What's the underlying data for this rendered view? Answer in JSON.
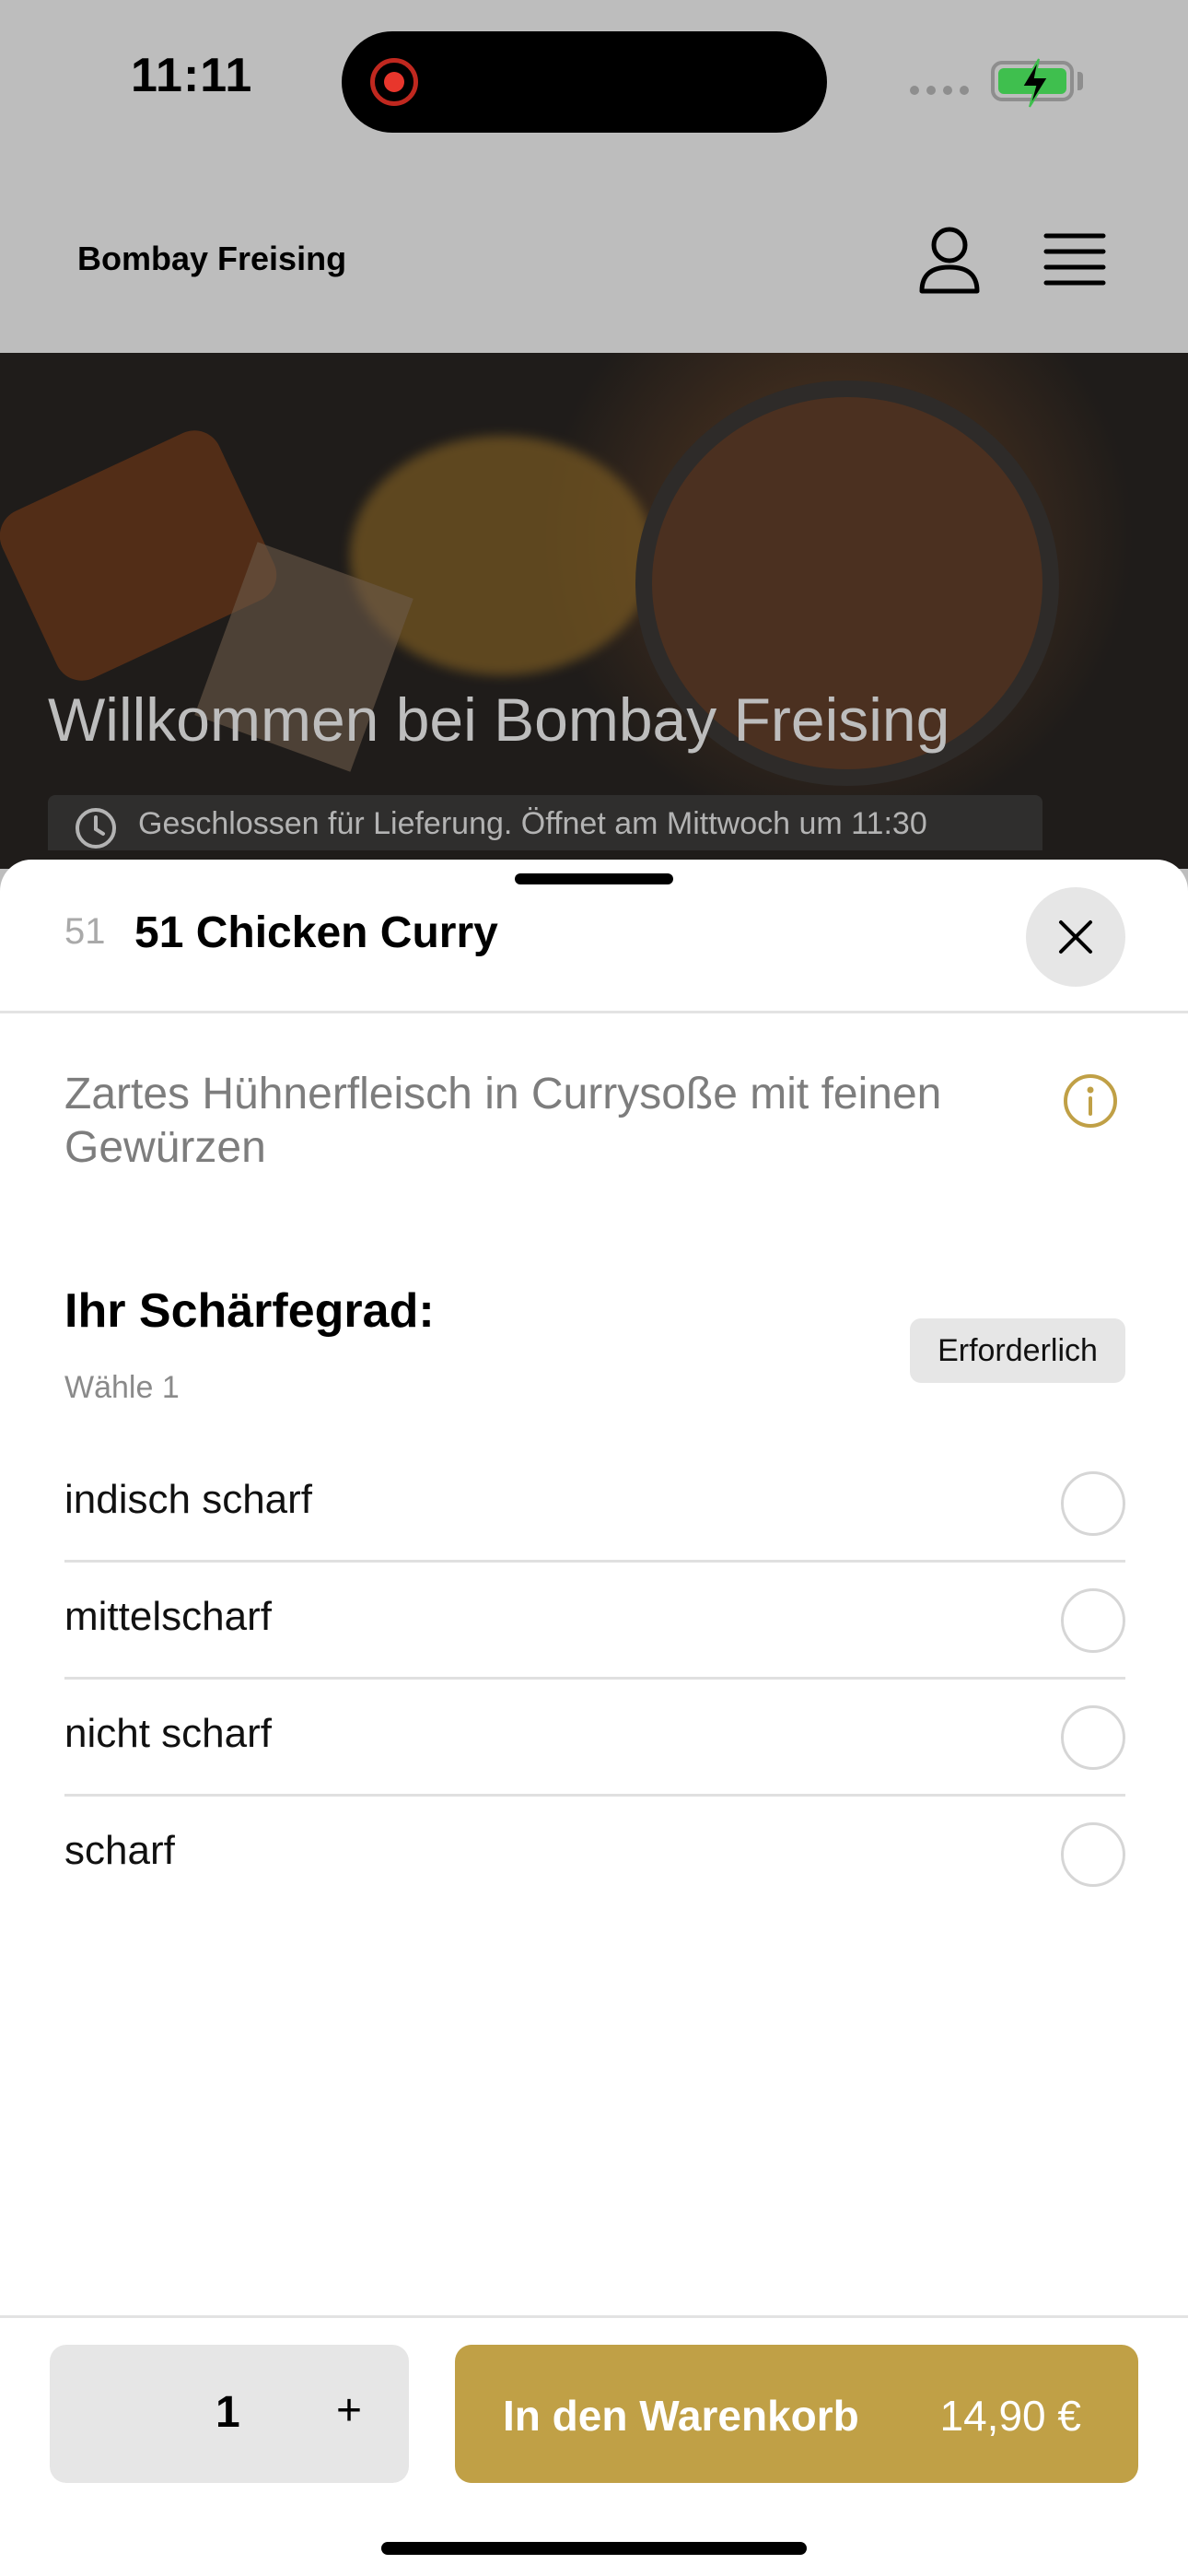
{
  "status_bar": {
    "time": "11:11"
  },
  "header": {
    "title": "Bombay Freising"
  },
  "hero": {
    "title": "Willkommen bei Bombay Freising",
    "status": "Geschlossen für Lieferung. Öffnet am Mittwoch um 11:30"
  },
  "item": {
    "number": "51",
    "name": "51 Chicken Curry",
    "description": "Zartes Hühnerfleisch in Currysoße mit feinen Gewürzen"
  },
  "spice_section": {
    "title": "Ihr Schärfegrad:",
    "subtitle": "Wähle 1",
    "badge": "Erforderlich",
    "options": [
      {
        "label": "indisch scharf",
        "selected": false
      },
      {
        "label": "mittelscharf",
        "selected": false
      },
      {
        "label": "nicht scharf",
        "selected": false
      },
      {
        "label": "scharf",
        "selected": false
      }
    ]
  },
  "footer": {
    "quantity": "1",
    "plus": "+",
    "cart_label": "In den Warenkorb",
    "price": "14,90 €"
  },
  "colors": {
    "accent": "#c0a046",
    "badge_bg": "#e6e6e6"
  }
}
